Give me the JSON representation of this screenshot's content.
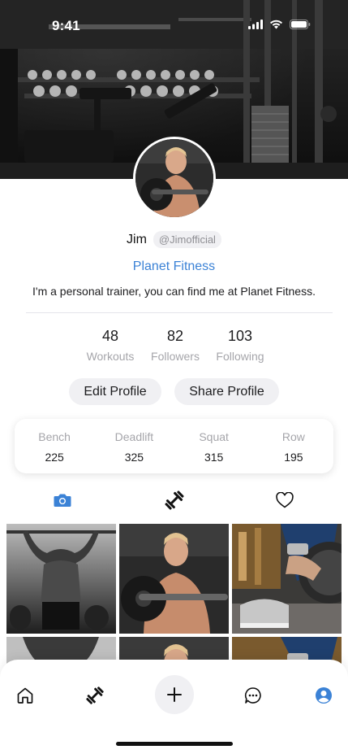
{
  "status": {
    "time": "9:41"
  },
  "profile": {
    "name": "Jim",
    "handle": "@Jimofficial",
    "gym": "Planet Fitness",
    "bio": "I'm a personal trainer, you can find me at Planet Fitness."
  },
  "stats": [
    {
      "value": "48",
      "label": "Workouts"
    },
    {
      "value": "82",
      "label": "Followers"
    },
    {
      "value": "103",
      "label": "Following"
    }
  ],
  "actions": {
    "edit": "Edit Profile",
    "share": "Share Profile"
  },
  "lifts": [
    {
      "label": "Bench",
      "value": "225"
    },
    {
      "label": "Deadlift",
      "value": "325"
    },
    {
      "label": "Squat",
      "value": "315"
    },
    {
      "label": "Row",
      "value": "195"
    }
  ],
  "tabs": [
    {
      "icon": "camera-icon",
      "active": true
    },
    {
      "icon": "dumbbell-icon",
      "active": false
    },
    {
      "icon": "heart-icon",
      "active": false
    }
  ],
  "bottom_nav": [
    {
      "icon": "home-icon"
    },
    {
      "icon": "dumbbell-icon"
    },
    {
      "icon": "plus-icon"
    },
    {
      "icon": "chat-icon"
    },
    {
      "icon": "profile-icon",
      "active": true
    }
  ],
  "colors": {
    "accent": "#3b82d6",
    "muted": "#a5a5aa",
    "chip": "#f0f0f3"
  }
}
